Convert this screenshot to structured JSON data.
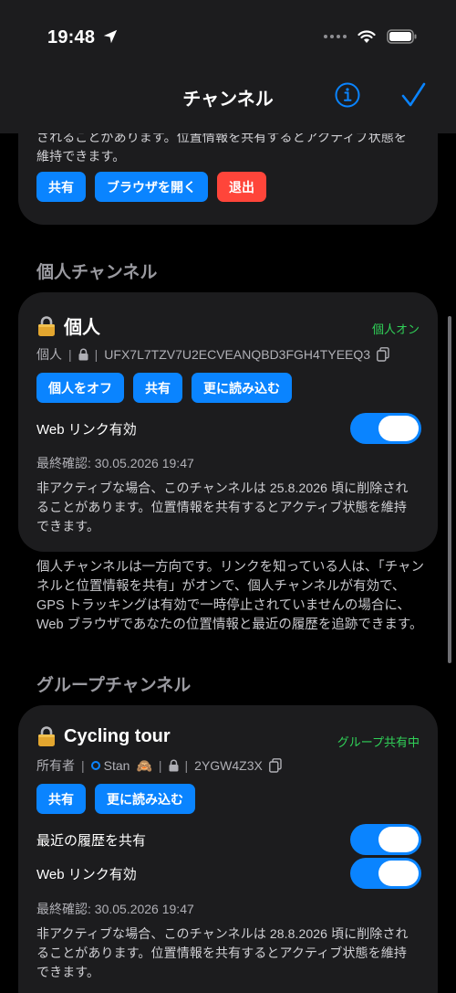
{
  "status_bar": {
    "time": "19:48"
  },
  "nav": {
    "title": "チャンネル"
  },
  "top_card": {
    "description": "されることがあります。位置情報を共有するとアクティブ状態を維持できます。",
    "buttons": {
      "share": "共有",
      "open_browser": "ブラウザを開く",
      "leave": "退出"
    }
  },
  "personal_section": {
    "header": "個人チャンネル",
    "card": {
      "title": "個人",
      "status": "個人オン",
      "meta_label": "個人",
      "channel_id": "UFX7L7TZV7U2ECVEANQBD3FGH4TYEEQ3",
      "buttons": {
        "turn_off": "個人をオフ",
        "share": "共有",
        "load_more": "更に読み込む"
      },
      "web_link": {
        "label": "Web リンク有効",
        "enabled": true
      },
      "last_check": "最終確認: 30.05.2026 19:47",
      "description": "非アクティブな場合、このチャンネルは 25.8.2026 頃に削除されることがあります。位置情報を共有するとアクティブ状態を維持できます。"
    },
    "footer": "個人チャンネルは一方向です。リンクを知っている人は、「チャンネルと位置情報を共有」がオンで、個人チャンネルが有効で、GPS トラッキングは有効で一時停止されていませんの場合に、Web ブラウザであなたの位置情報と最近の履歴を追跡できます。"
  },
  "group_section": {
    "header": "グループチャンネル",
    "card": {
      "title": "Cycling tour",
      "status": "グループ共有中",
      "owner_label": "所有者",
      "owner_name": "Stan",
      "owner_emoji": "🙈",
      "channel_id": "2YGW4Z3X",
      "buttons": {
        "share": "共有",
        "load_more": "更に読み込む"
      },
      "share_history": {
        "label": "最近の履歴を共有",
        "enabled": true
      },
      "web_link": {
        "label": "Web リンク有効",
        "enabled": true
      },
      "last_check": "最終確認: 30.05.2026 19:47",
      "description": "非アクティブな場合、このチャンネルは 28.8.2026 頃に削除されることがあります。位置情報を共有するとアクティブ状態を維持できます。"
    }
  },
  "colors": {
    "accent": "#0a84ff",
    "danger": "#ff453a",
    "status_green": "#30d158",
    "card_bg": "#1c1c1e",
    "background": "#000000"
  }
}
